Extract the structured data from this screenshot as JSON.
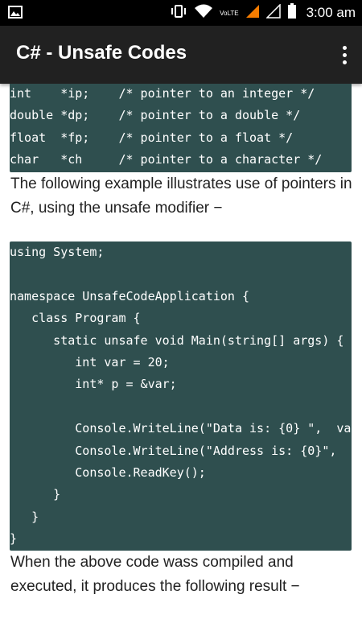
{
  "status_bar": {
    "time": "3:00 am",
    "network": "VoLTE",
    "icons": [
      "image-notification-icon",
      "vibrate-icon",
      "wifi-icon",
      "signal-icon",
      "battery-icon"
    ]
  },
  "app_bar": {
    "title": "C# - Unsafe Codes",
    "menu_icon": "overflow-menu-icon"
  },
  "content": {
    "code_block_1": [
      "int    *ip;    /* pointer to an integer */",
      "double *dp;    /* pointer to a double */",
      "float  *fp;    /* pointer to a float */",
      "char   *ch     /* pointer to a character */"
    ],
    "paragraph_1": "The following example illustrates use of pointers in C#, using the unsafe modifier −",
    "code_block_2": [
      "using System;",
      "",
      "namespace UnsafeCodeApplication {",
      "   class Program {",
      "      static unsafe void Main(string[] args) {",
      "         int var = 20;",
      "         int* p = &var;",
      "",
      "         Console.WriteLine(\"Data is: {0} \",  va",
      "         Console.WriteLine(\"Address is: {0}\",",
      "         Console.ReadKey();",
      "      }",
      "   }",
      "}"
    ],
    "paragraph_2": "When the above code wass compiled and executed, it produces the following result −"
  },
  "colors": {
    "code_background": "#2f4f4f",
    "app_bar": "#212121",
    "status_bar": "#000000"
  }
}
